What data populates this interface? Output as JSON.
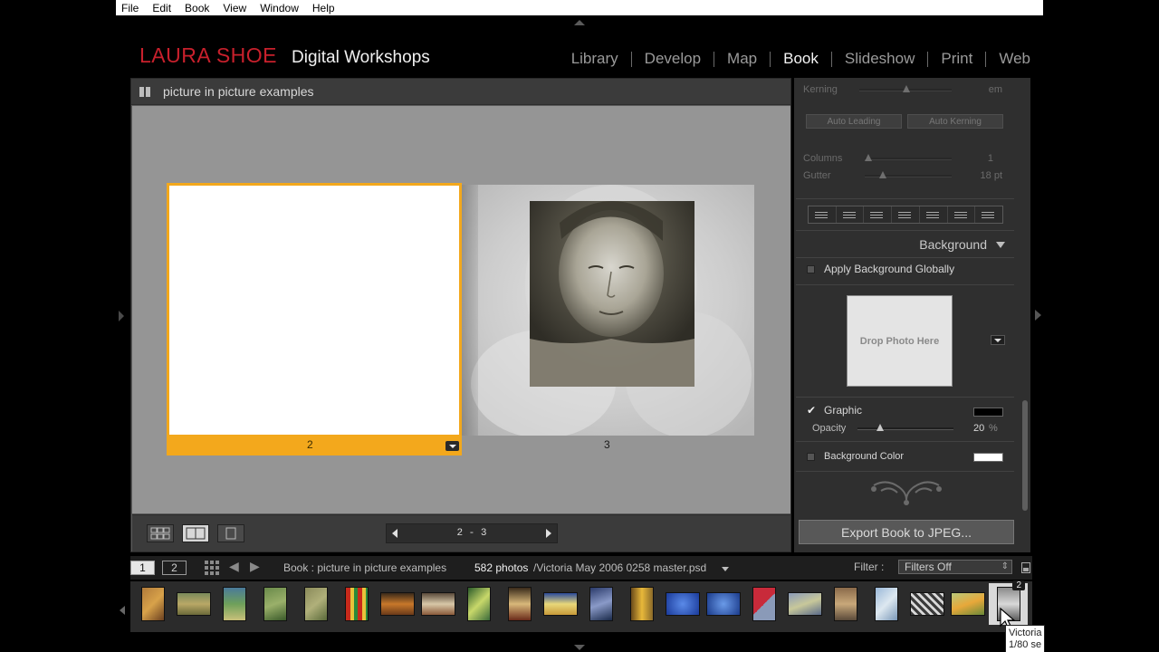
{
  "menu": [
    "File",
    "Edit",
    "Book",
    "View",
    "Window",
    "Help"
  ],
  "identity": {
    "name": "LAURA SHOE",
    "subtitle": "Digital Workshops"
  },
  "modules": [
    {
      "label": "Library",
      "active": false
    },
    {
      "label": "Develop",
      "active": false
    },
    {
      "label": "Map",
      "active": false
    },
    {
      "label": "Book",
      "active": true
    },
    {
      "label": "Slideshow",
      "active": false
    },
    {
      "label": "Print",
      "active": false
    },
    {
      "label": "Web",
      "active": false
    }
  ],
  "document": {
    "title": "picture in picture examples",
    "left_page_number": "2",
    "right_page_number": "3",
    "pager_text": "2 - 3"
  },
  "right_panel": {
    "kerning_label": "Kerning",
    "kerning_unit": "em",
    "auto_leading": "Auto Leading",
    "auto_kerning": "Auto Kerning",
    "columns_label": "Columns",
    "columns_value": "1",
    "gutter_label": "Gutter",
    "gutter_value": "18 pt",
    "background_section": "Background",
    "apply_globally": "Apply Background Globally",
    "apply_globally_checked": false,
    "drop_photo": "Drop Photo Here",
    "graphic_label": "Graphic",
    "graphic_checked": true,
    "graphic_color": "#000000",
    "opacity_label": "Opacity",
    "opacity_value": "20",
    "opacity_unit": "%",
    "background_color_label": "Background Color",
    "background_color_checked": false,
    "background_color": "#ffffff",
    "export_button": "Export Book to JPEG..."
  },
  "filmbar": {
    "view1": "1",
    "view2": "2",
    "source": "Book : picture in picture examples",
    "count": "582 photos",
    "file": "/Victoria May 2006 0258 master.psd",
    "filter_label": "Filter :",
    "filter_value": "Filters Off"
  },
  "filmstrip": {
    "selected_badge": "2",
    "tooltip_line1": "Victoria",
    "tooltip_line2": "1/80 se"
  },
  "colors": {
    "accent_orange": "#f3a81c",
    "brand_red": "#c8202c"
  }
}
